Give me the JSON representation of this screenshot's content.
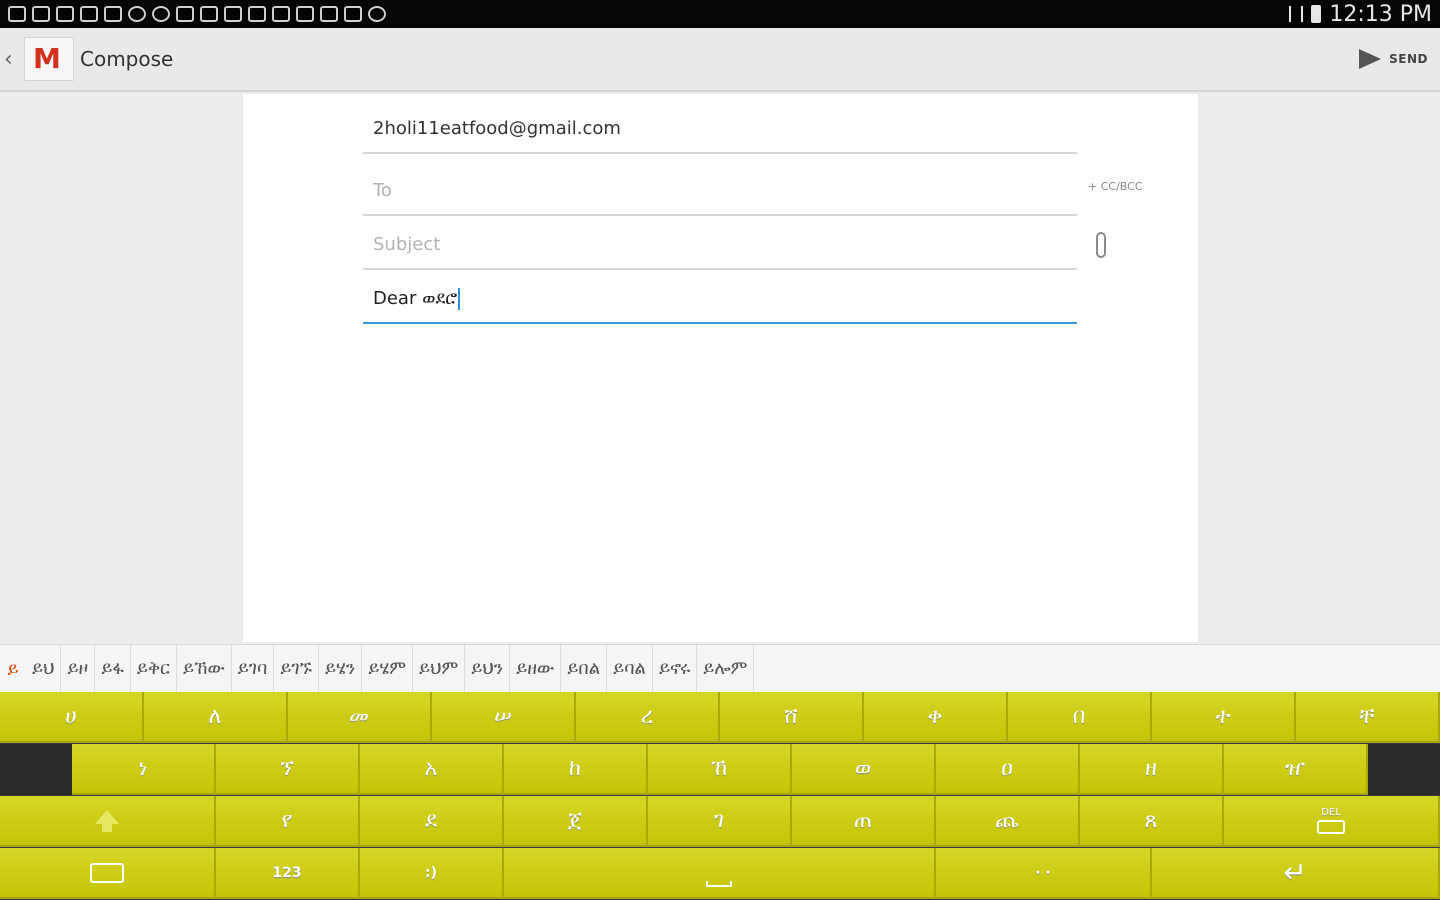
{
  "status_bar": {
    "time": "12:13 PM",
    "notification_icons": [
      "mail-icon",
      "mail-icon",
      "mail-icon",
      "mail-icon",
      "gallery-icon",
      "g-icon",
      "g-icon",
      "cloud-icon",
      "card-icon",
      "screen-icon",
      "wifi-icon",
      "battery-icon",
      "chat-icon",
      "bag-icon",
      "shop-icon",
      "compass-icon"
    ]
  },
  "action_bar": {
    "title": "Compose",
    "logo_letter": "M",
    "send_label": "SEND"
  },
  "compose": {
    "from": "2holi11eatfood@gmail.com",
    "to_placeholder": "To",
    "cc_bcc": "+ CC/BCC",
    "subject_placeholder": "Subject",
    "body_text": "Dear ወደሮ"
  },
  "suggestions": {
    "first": "ይ",
    "items": [
      "ይህ",
      "ይዞ",
      "ይፋ",
      "ይቅር",
      "ይኸው",
      "ይገባ",
      "ይገኙ",
      "ይሄን",
      "ይሄም",
      "ይህም",
      "ይህን",
      "ይዘው",
      "ይበል",
      "ይባል",
      "ይኖሩ",
      "ይሎም"
    ]
  },
  "keyboard": {
    "row1": [
      "ሀ",
      "ለ",
      "መ",
      "ሠ",
      "ረ",
      "ሸ",
      "ቀ",
      "በ",
      "ተ",
      "ቸ"
    ],
    "row2": [
      "ነ",
      "ኘ",
      "አ",
      "ከ",
      "ኸ",
      "ወ",
      "ዐ",
      "ዘ",
      "ዠ"
    ],
    "row3": [
      "የ",
      "ደ",
      "ጀ",
      "ገ",
      "ጠ",
      "ጨ",
      "ጸ"
    ],
    "numbers_label": "123",
    "emoji_label": ":)",
    "del_label": "DEL",
    "period_label": "· ·"
  }
}
